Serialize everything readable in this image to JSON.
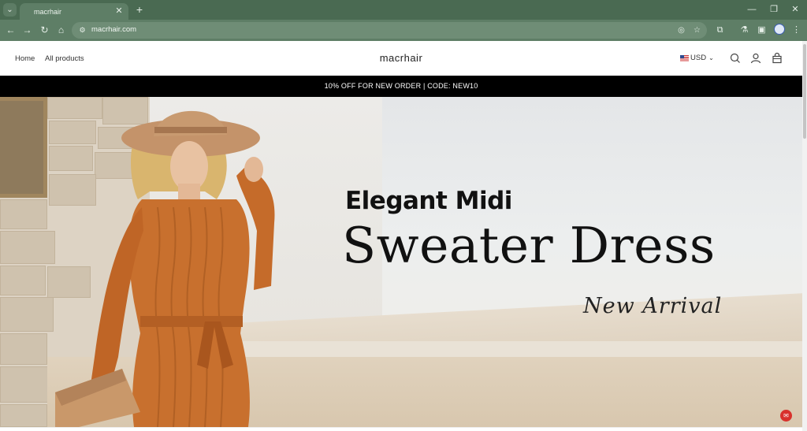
{
  "browser": {
    "tab_title": "macrhair",
    "url": "macrhair.com",
    "accent": "#4a6a52"
  },
  "header": {
    "nav": [
      {
        "label": "Home"
      },
      {
        "label": "All products"
      }
    ],
    "logo": "macrhair",
    "currency": "USD"
  },
  "promo": {
    "text": "10% OFF FOR NEW ORDER | CODE: NEW10"
  },
  "hero": {
    "line1": "Elegant Midi",
    "line2": "Sweater Dress",
    "line3": "New Arrival"
  },
  "icons": {
    "chat": "chat-bubble-icon"
  }
}
